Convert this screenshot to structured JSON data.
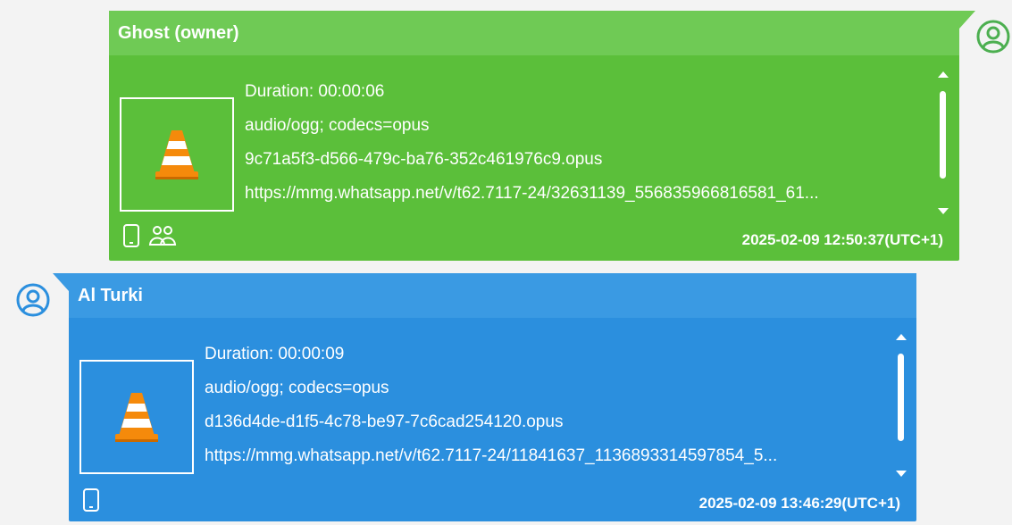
{
  "messages": [
    {
      "sender": "Ghost (owner)",
      "lines": [
        "Duration: 00:00:06",
        "audio/ogg; codecs=opus",
        "9c71a5f3-d566-479c-ba76-352c461976c9.opus",
        "https://mmg.whatsapp.net/v/t62.7117-24/32631139_556835966816581_61..."
      ],
      "timestamp": "2025-02-09 12:50:37(UTC+1)",
      "colors": {
        "bubble": "#5bbf3a",
        "header": "#6fca55",
        "avatar": "#4caf50"
      },
      "icons": [
        "phone-icon",
        "group-icon",
        "vlc-icon",
        "user-avatar-icon"
      ]
    },
    {
      "sender": "Al Turki",
      "lines": [
        "Duration: 00:00:09",
        "audio/ogg; codecs=opus",
        "d136d4de-d1f5-4c78-be97-7c6cad254120.opus",
        "https://mmg.whatsapp.net/v/t62.7117-24/11841637_1136893314597854_5..."
      ],
      "timestamp": "2025-02-09 13:46:29(UTC+1)",
      "colors": {
        "bubble": "#2b8fde",
        "header": "#3a9ae3",
        "avatar": "#2b8fde"
      },
      "icons": [
        "phone-icon",
        "vlc-icon",
        "user-avatar-icon"
      ]
    }
  ]
}
